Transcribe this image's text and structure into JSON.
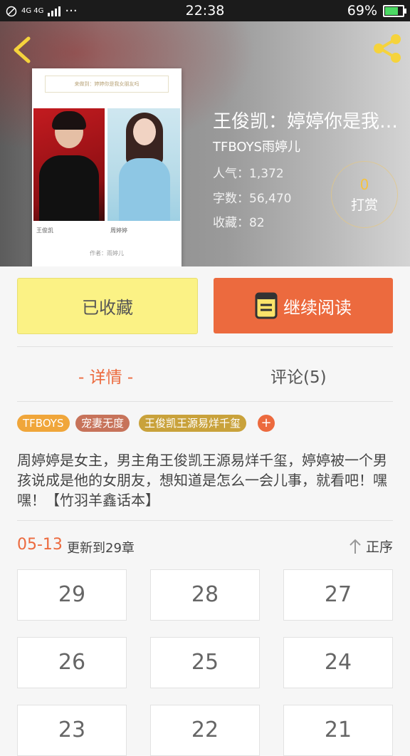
{
  "status_bar": {
    "network": "4G 4G",
    "dots": "···",
    "time": "22:38",
    "battery": "69%"
  },
  "header": {
    "cover_top_text": "来做到：婷婷你是我女朋友吗",
    "cover_left_caption": "王俊凯",
    "cover_right_caption": "周婷婷",
    "cover_bottom_text": "作者：雨婷儿",
    "title": "王俊凯：婷婷你是我女朋友吗",
    "author": "TFBOYS雨婷儿",
    "stats": [
      {
        "label": "人气：",
        "value": "1,372"
      },
      {
        "label": "字数：",
        "value": "56,470"
      },
      {
        "label": "收藏：",
        "value": "82"
      }
    ],
    "tip_count": "0",
    "tip_label": "打赏"
  },
  "actions": {
    "favorite_label": "已收藏",
    "read_label": "继续阅读"
  },
  "tabs": {
    "detail": "- 详情 -",
    "comments": "评论(5)"
  },
  "tags": [
    {
      "label": "TFBOYS",
      "color": "#f0a63a"
    },
    {
      "label": "宠妻无度",
      "color": "#c7735a"
    },
    {
      "label": "王俊凯王源易烊千玺",
      "color": "#c9a23b"
    }
  ],
  "tag_add": "+",
  "description": "周婷婷是女主，男主角王俊凯王源易烊千玺，婷婷被一个男孩说成是他的女朋友，想知道是怎么一会儿事，就看吧！嘿嘿！【竹羽羊鑫话本】",
  "update": {
    "date": "05-13",
    "text": "更新到29章",
    "sort_label": "正序"
  },
  "chapters": [
    "29",
    "28",
    "27",
    "26",
    "25",
    "24",
    "23",
    "22",
    "21"
  ],
  "colors": {
    "accent": "#ec6a3e",
    "favorite_bg": "#fbf285",
    "tip_gold": "#f5c342"
  }
}
